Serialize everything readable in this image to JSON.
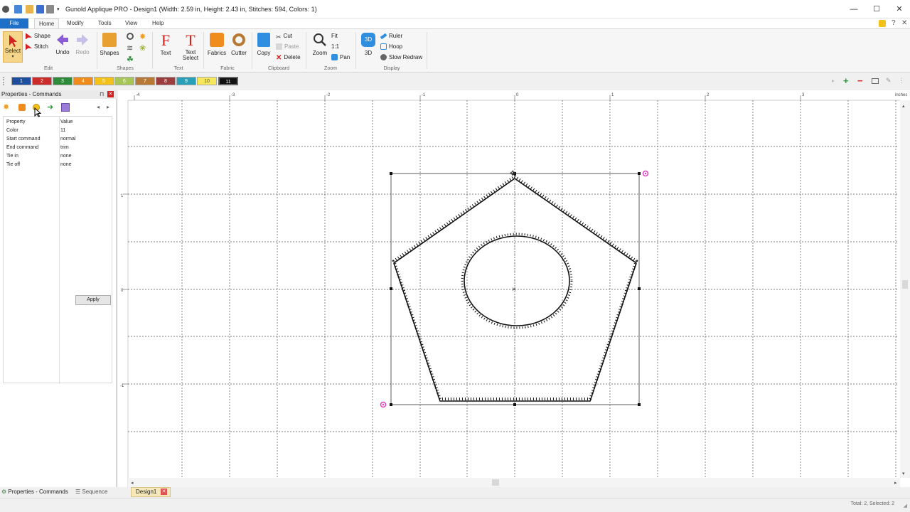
{
  "window": {
    "title": "Gunold Applique PRO - Design1 (Width: 2.59 in, Height: 2.43 in, Stitches: 594, Colors: 1)",
    "controls": [
      "—",
      "☐",
      "✕"
    ]
  },
  "menubar": {
    "file": "File",
    "items": [
      "Home",
      "Modify",
      "Tools",
      "View",
      "Help"
    ]
  },
  "ribbon": {
    "edit": {
      "label": "Edit",
      "select": "Select",
      "shape": "Shape",
      "stitch": "Stitch",
      "undo": "Undo",
      "redo": "Redo"
    },
    "shapes": {
      "label": "Shapes",
      "shapes": "Shapes"
    },
    "text": {
      "label": "Text",
      "text": "Text",
      "text_select": "Text Select"
    },
    "fabric": {
      "label": "Fabric",
      "fabrics": "Fabrics",
      "cutter": "Cutter"
    },
    "clipboard": {
      "label": "Clipboard",
      "copy": "Copy",
      "cut": "Cut",
      "paste": "Paste",
      "delete": "Delete"
    },
    "zoom": {
      "label": "Zoom",
      "zoom": "Zoom",
      "fit": "Fit",
      "one_to_one": "1:1",
      "pan": "Pan"
    },
    "display": {
      "label": "Display",
      "three_d": "3D",
      "ruler": "Ruler",
      "hoop": "Hoop",
      "slow_redraw": "Slow Redraw"
    }
  },
  "colorbar": {
    "swatches": [
      {
        "label": "1",
        "color": "#1f4e9c"
      },
      {
        "label": "2",
        "color": "#cc2c2c"
      },
      {
        "label": "3",
        "color": "#2e8b3a"
      },
      {
        "label": "4",
        "color": "#f08c1e"
      },
      {
        "label": "5",
        "color": "#f2c21a"
      },
      {
        "label": "6",
        "color": "#a6c65a"
      },
      {
        "label": "7",
        "color": "#b87836"
      },
      {
        "label": "8",
        "color": "#9c3c3c"
      },
      {
        "label": "9",
        "color": "#2aa0b8"
      },
      {
        "label": "10",
        "color": "#f6e85a"
      },
      {
        "label": "11",
        "color": "#111111"
      }
    ],
    "selected": "11"
  },
  "properties_panel": {
    "title": "Properties - Commands",
    "columns": [
      "Property",
      "Value"
    ],
    "rows": [
      {
        "property": "Color",
        "value": "11"
      },
      {
        "property": "Start command",
        "value": "normal"
      },
      {
        "property": "End command",
        "value": "trim"
      },
      {
        "property": "Tie in",
        "value": "none"
      },
      {
        "property": "Tie off",
        "value": "none"
      }
    ],
    "apply": "Apply"
  },
  "ruler": {
    "h_labels": [
      "-4",
      "-3",
      "-2",
      "-1",
      "0",
      "1",
      "2",
      "3"
    ],
    "units": "inches",
    "v_labels": [
      "1",
      "0",
      "-1"
    ]
  },
  "bottom_tabs": {
    "properties": "Properties - Commands",
    "sequence": "Sequence",
    "document": "Design1"
  },
  "status": {
    "text": "Total: 2, Selected: 2"
  },
  "accent": "#1e6fc8"
}
